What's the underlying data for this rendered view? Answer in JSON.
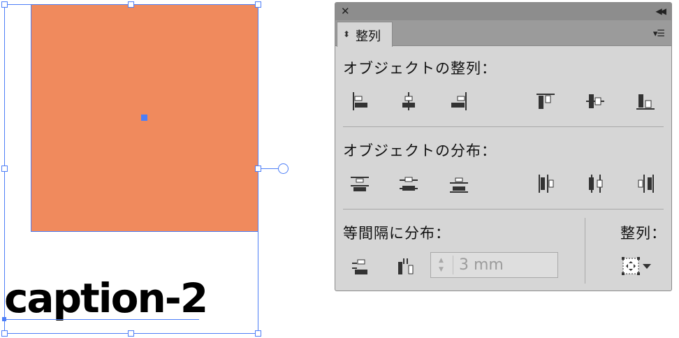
{
  "canvas": {
    "caption_text": "caption-2",
    "shape_fill": "#f08a5d",
    "selection_color": "#4d7ef7"
  },
  "panel": {
    "close_icon": "close-icon",
    "collapse_icon": "double-chevron-left-icon",
    "tab_label": "整列",
    "menu_icon": "panel-menu-icon",
    "align_objects": {
      "title": "オブジェクトの整列：",
      "buttons": [
        "align-left-icon",
        "align-horizontal-center-icon",
        "align-right-icon",
        "align-top-icon",
        "align-vertical-center-icon",
        "align-bottom-icon"
      ]
    },
    "distribute_objects": {
      "title": "オブジェクトの分布：",
      "buttons": [
        "distribute-top-icon",
        "distribute-vertical-center-icon",
        "distribute-bottom-icon",
        "distribute-left-icon",
        "distribute-horizontal-center-icon",
        "distribute-right-icon"
      ]
    },
    "distribute_spacing": {
      "title": "等間隔に分布：",
      "buttons": [
        "distribute-vertical-space-icon",
        "distribute-horizontal-space-icon"
      ],
      "spacing_value": "3 mm"
    },
    "align_to": {
      "title": "整列：",
      "icon": "align-to-selection-icon"
    }
  }
}
